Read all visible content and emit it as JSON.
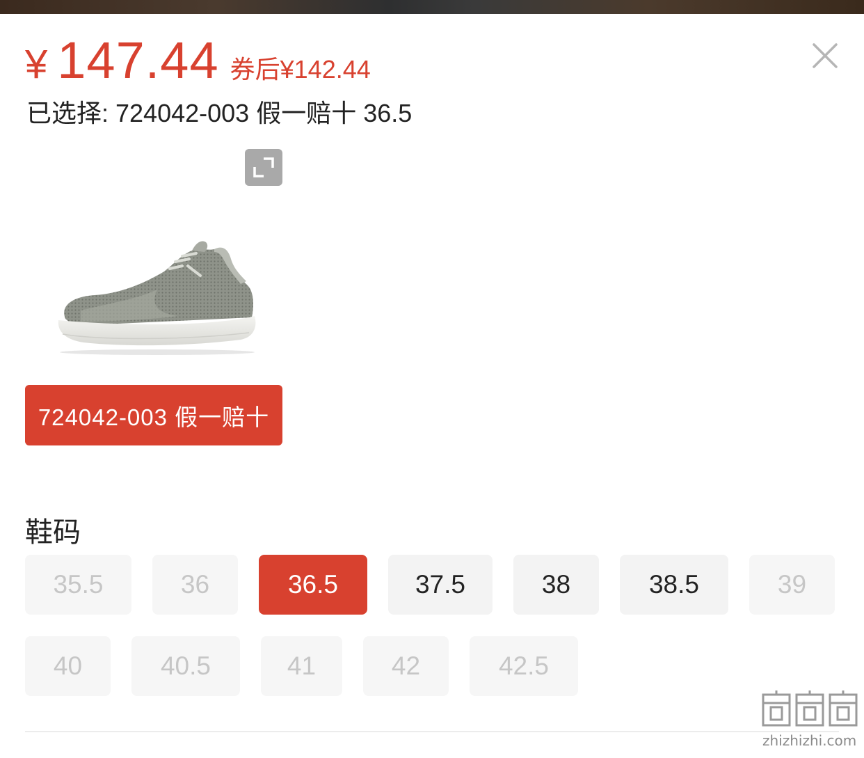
{
  "price": {
    "currency": "¥",
    "amount": "147.44",
    "coupon_label": "券后",
    "coupon_price": "¥142.44"
  },
  "selected": {
    "label": "已选择:",
    "value": "724042-003 假一赔十 36.5"
  },
  "variant": {
    "label": "724042-003 假一赔十"
  },
  "sizes": {
    "title": "鞋码",
    "options": [
      {
        "label": "35.5",
        "state": "disabled"
      },
      {
        "label": "36",
        "state": "disabled"
      },
      {
        "label": "36.5",
        "state": "active"
      },
      {
        "label": "37.5",
        "state": "available"
      },
      {
        "label": "38",
        "state": "available"
      },
      {
        "label": "38.5",
        "state": "available"
      },
      {
        "label": "39",
        "state": "disabled"
      },
      {
        "label": "40",
        "state": "disabled"
      },
      {
        "label": "40.5",
        "state": "disabled"
      },
      {
        "label": "41",
        "state": "disabled"
      },
      {
        "label": "42",
        "state": "disabled"
      },
      {
        "label": "42.5",
        "state": "disabled"
      }
    ]
  },
  "icons": {
    "close": "close-icon",
    "expand": "expand-icon"
  },
  "colors": {
    "accent": "#d8412f",
    "chip_bg": "#f3f3f3",
    "chip_disabled_text": "#c6c6c6"
  },
  "watermark": {
    "text": "zhizhizhi.com"
  }
}
